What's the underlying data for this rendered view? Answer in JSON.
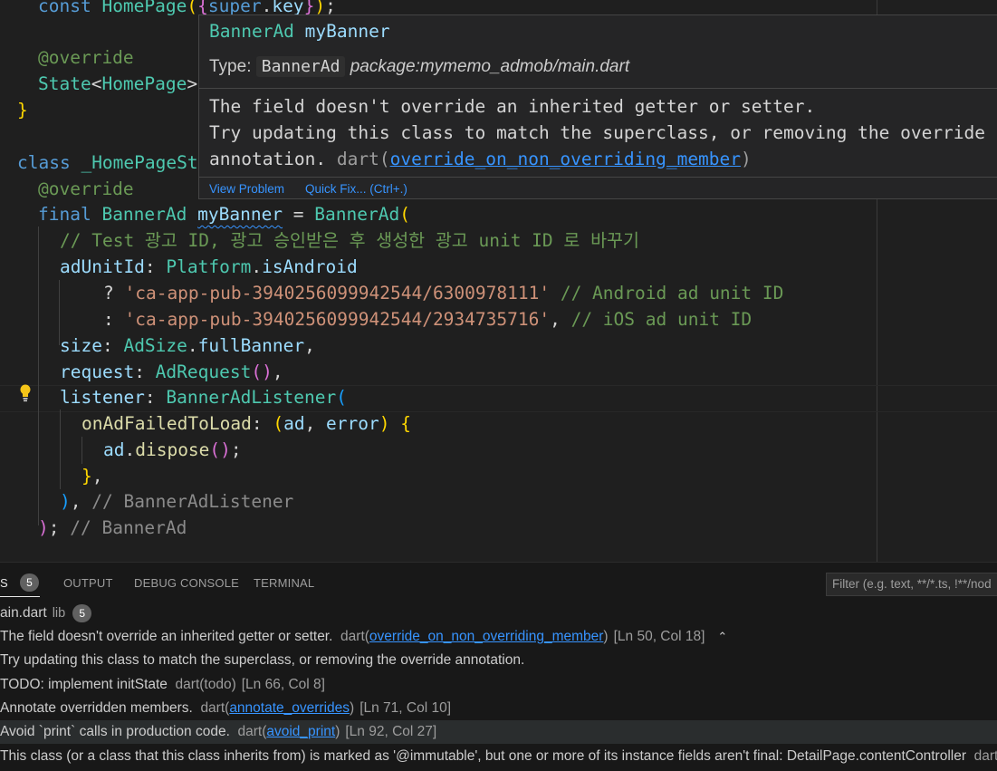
{
  "editor": {
    "line0": {
      "kw": "const",
      "cls": "HomePage",
      "p1": "(",
      "b2": "{",
      "kw2": "super",
      "dot": ".",
      "var": "key",
      "b2c": "}",
      "p2": ")",
      "semi": ";"
    },
    "line2": {
      "ann": "@override"
    },
    "line3": {
      "cls": "State",
      "lt": "<",
      "cls2": "HomePage",
      "gt": ">"
    },
    "line4": {
      "brace": "}"
    },
    "line6": {
      "kw": "class",
      "cls": "_HomePageSt"
    },
    "line7": {
      "ann": "@override"
    },
    "line8": {
      "kw": "final",
      "cls": "BannerAd",
      "var": "myBanner",
      "eq": " = ",
      "cls2": "BannerAd",
      "paren": "("
    },
    "line9": {
      "cmt": "// Test 광고 ID, 광고 승인받은 후 생성한 광고 unit ID 로 바꾸기"
    },
    "line10": {
      "var": "adUnitId",
      "colon": ": ",
      "cls": "Platform",
      "dot": ".",
      "var2": "isAndroid"
    },
    "line11": {
      "q": "? ",
      "str": "'ca-app-pub-3940256099942544/6300978111'",
      "cmt": " // Android ad unit ID"
    },
    "line12": {
      "c": ": ",
      "str": "'ca-app-pub-3940256099942544/2934735716'",
      "comma": ", ",
      "cmt": "// iOS ad unit ID"
    },
    "line13": {
      "var": "size",
      "colon": ": ",
      "cls": "AdSize",
      "dot": ".",
      "var2": "fullBanner",
      "comma": ","
    },
    "line14": {
      "var": "request",
      "colon": ": ",
      "cls": "AdRequest",
      "paren": "()",
      "comma": ","
    },
    "line15": {
      "var": "listener",
      "colon": ": ",
      "cls": "BannerAdListener",
      "paren": "("
    },
    "line16": {
      "fn": "onAdFailedToLoad",
      "colon": ": ",
      "p": "(",
      "var": "ad",
      "comma": ", ",
      "var2": "error",
      "pc": ")",
      "brace": " {"
    },
    "line17": {
      "var": "ad",
      "dot": ".",
      "fn": "dispose",
      "paren": "()",
      "semi": ";"
    },
    "line18": {
      "brace": "}",
      "comma": ","
    },
    "line19": {
      "paren": ")",
      "comma": ", ",
      "cmt": "// BannerAdListener"
    },
    "line20": {
      "paren": ")",
      "semi": ";",
      "cmt": " // BannerAd"
    }
  },
  "hover": {
    "sig_cls": "BannerAd",
    "sig_var": " myBanner",
    "type_label": "Type: ",
    "type_chip": "BannerAd",
    "type_pkg": " package:mymemo_admob/main.dart",
    "msg_line1": "The field doesn't override an inherited getter or setter.",
    "msg_line2": "Try updating this class to match the superclass, or removing the override",
    "msg_line3": "annotation.",
    "msg_src": " dart(",
    "msg_rule": "override_on_non_overriding_member",
    "msg_close": ")",
    "view_problem": "View Problem",
    "quick_fix": "Quick Fix... (Ctrl+.)"
  },
  "panel": {
    "tabs": {
      "problems": "S",
      "problems_count": "5",
      "output": "OUTPUT",
      "debug": "DEBUG CONSOLE",
      "terminal": "TERMINAL"
    },
    "filter_placeholder": "Filter (e.g. text, **/*.ts, !**/nod",
    "file": {
      "name": "ain.dart",
      "dir": "lib",
      "count": "5"
    },
    "problems": [
      {
        "msg": "The field doesn't override an inherited getter or setter.",
        "src": "dart(",
        "rule": "override_on_non_overriding_member",
        "close": ")",
        "loc": "[Ln 50, Col 18]"
      },
      {
        "msg": "Try updating this class to match the superclass, or removing the override annotation."
      },
      {
        "msg": "TODO: implement initState",
        "src": "dart(todo)",
        "loc": "[Ln 66, Col 8]"
      },
      {
        "msg": "Annotate overridden members.",
        "src": "dart(",
        "rule": "annotate_overrides",
        "close": ")",
        "loc": "[Ln 71, Col 10]"
      },
      {
        "msg": "Avoid `print` calls in production code.",
        "src": "dart(",
        "rule": "avoid_print",
        "close": ")",
        "loc": "[Ln 92, Col 27]"
      },
      {
        "msg": "This class (or a class that this class inherits from) is marked as '@immutable', but one or more of its instance fields aren't final: DetailPage.contentController",
        "src": "dart"
      }
    ]
  }
}
